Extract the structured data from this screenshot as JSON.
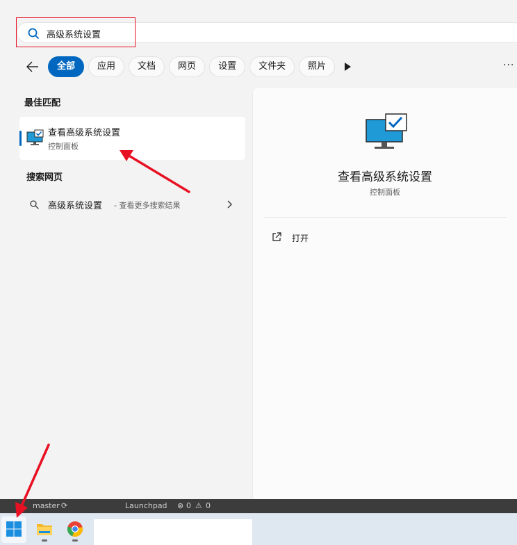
{
  "search": {
    "query": "高级系统设置"
  },
  "filters": {
    "tabs": [
      {
        "label": "全部",
        "active": true
      },
      {
        "label": "应用",
        "active": false
      },
      {
        "label": "文档",
        "active": false
      },
      {
        "label": "网页",
        "active": false
      },
      {
        "label": "设置",
        "active": false
      },
      {
        "label": "文件夹",
        "active": false
      },
      {
        "label": "照片",
        "active": false
      }
    ]
  },
  "best_match": {
    "section_title": "最佳匹配",
    "title": "查看高级系统设置",
    "subtitle": "控制面板",
    "icon": "monitor-check-icon"
  },
  "web_search": {
    "section_title": "搜索网页",
    "query": "高级系统设置",
    "suffix": "- 查看更多搜索结果"
  },
  "detail": {
    "title": "查看高级系统设置",
    "subtitle": "控制面板",
    "action_label": "打开"
  },
  "statusbar": {
    "branch": "master",
    "launchpad": "Launchpad",
    "errors": "0",
    "warnings": "0"
  },
  "colors": {
    "accent": "#0067c0",
    "annotation_red": "#e81123"
  }
}
